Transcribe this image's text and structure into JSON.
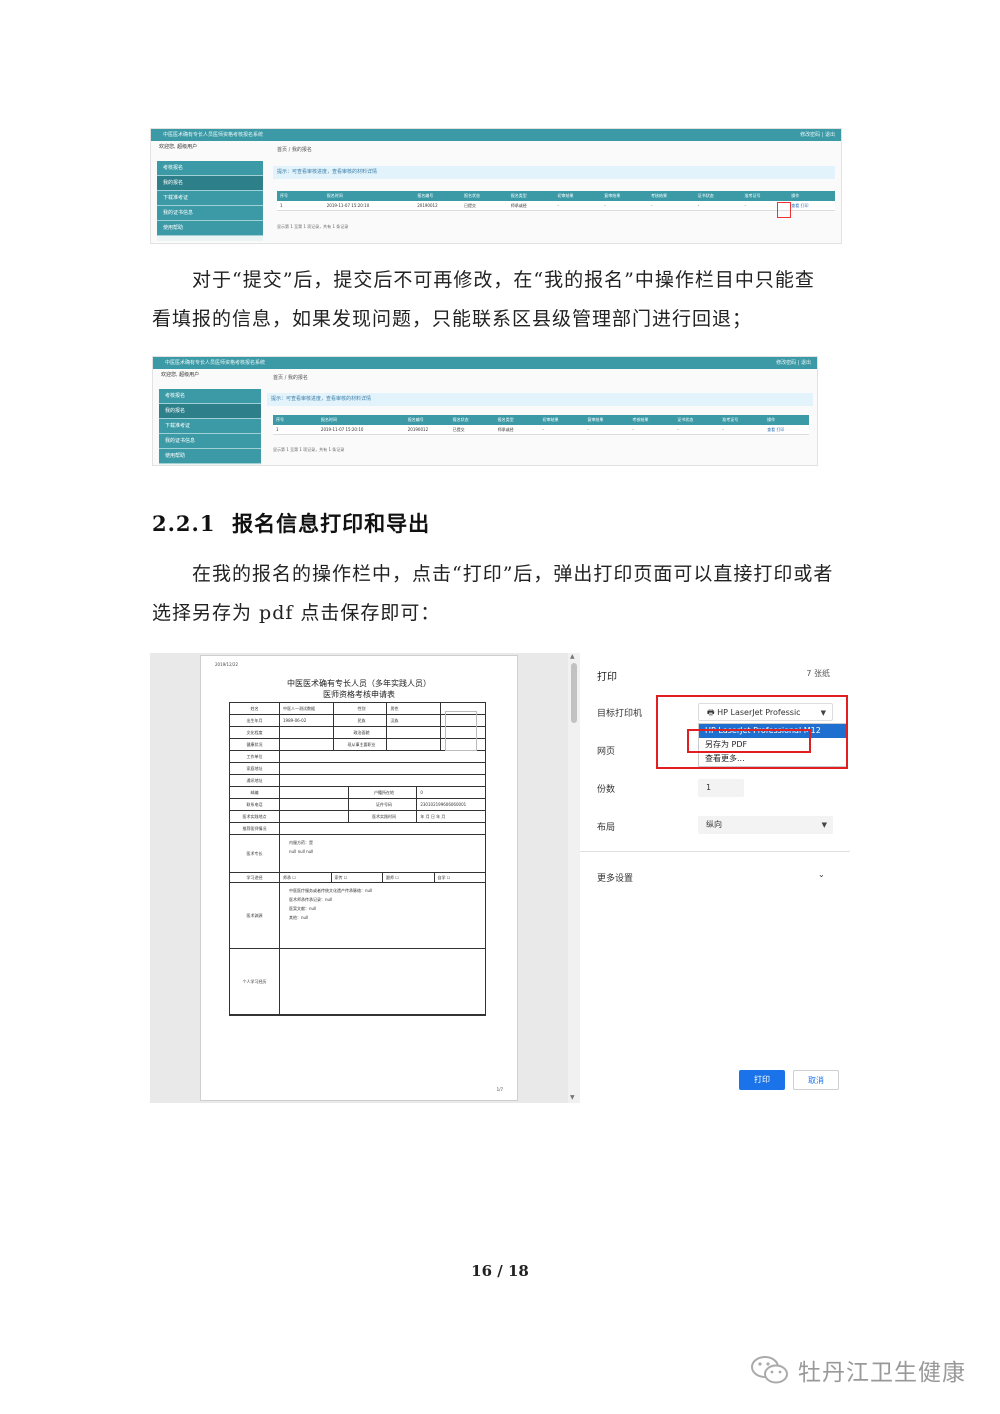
{
  "screenshot1": {
    "title": "中医医术确有专长人员医师资格考核报名系统",
    "top_right": "修改密码 | 退出",
    "user": "欢迎您, 超级用户",
    "breadcrumb": "首页 / 我的报名",
    "menu": [
      "考核报名",
      "我的报名",
      "下载准考证",
      "我的证书信息",
      "使用帮助"
    ],
    "tip": "提示：可查看审核进度，查看审核的材料详情",
    "headers": [
      "序号",
      "报名时间",
      "报名编号",
      "报名状态",
      "报名类型",
      "初审结果",
      "复审结果",
      "考核结果",
      "证书状态",
      "准考证号",
      "操作"
    ],
    "row": [
      "1",
      "2019-11-07 15:20:10",
      "20190012",
      "已提交",
      "师承或经",
      "-",
      "-",
      "-",
      "-",
      "-",
      "查看 打印"
    ],
    "pager": "显示第 1 至第 1 项记录，共有 1 条记录"
  },
  "paragraph1": {
    "line1": "对于“提交”后，提交后不可再修改，在“我的报名”中操作栏目中只能查",
    "line2": "看填报的信息，如果发现问题，只能联系区县级管理部门进行回退；"
  },
  "screenshot2": {
    "title": "中医医术确有专长人员医师资格考核报名系统",
    "top_right": "修改密码 | 退出",
    "user": "欢迎您, 超级用户",
    "breadcrumb": "首页 / 我的报名",
    "menu": [
      "考核报名",
      "我的报名",
      "下载准考证",
      "我的证书信息",
      "使用帮助"
    ],
    "tip": "提示：可查看审核进度，查看审核的材料详情",
    "headers": [
      "序号",
      "报名时间",
      "报名编号",
      "报名状态",
      "报名类型",
      "初审结果",
      "复审结果",
      "考核结果",
      "证书状态",
      "准考证号",
      "操作"
    ],
    "row": [
      "1",
      "2019-11-07 15:20:10",
      "20190012",
      "已提交",
      "师承或经",
      "-",
      "-",
      "-",
      "-",
      "-",
      "查看 打印"
    ],
    "pager": "显示第 1 至第 1 项记录，共有 1 条记录"
  },
  "section": {
    "number": "2.2.1",
    "title": "报名信息打印和导出"
  },
  "paragraph2": {
    "line1": "在我的报名的操作栏中，点击“打印”后，弹出打印页面可以直接打印或者",
    "line2": "选择另存为 pdf 点击保存即可："
  },
  "print_preview": {
    "date": "2019/12/22",
    "title_line1": "中医医术确有专长人员（多年实践人员）",
    "title_line2": "医师资格考核申请表",
    "fields": {
      "name_label": "姓名",
      "name_value": "中医人一测试数据",
      "sex_label": "性别",
      "sex_value": "男性",
      "birth_label": "出生年月",
      "birth_value": "1989-06-02",
      "nation_label": "民族",
      "nation_value": "汉族",
      "edu_label": "文化程度",
      "politics_label": "政治面貌",
      "health_label": "健康状况",
      "job_label": "现从事主要职业",
      "unit_label": "工作单位",
      "home_label": "家庭地址",
      "comm_label": "通讯地址",
      "postcode_label": "邮编",
      "hukou_label": "户籍所在地",
      "hukou_value": "0",
      "phone_label": "联系电话",
      "id_label": "证件号码",
      "id_value": "230102199606060001",
      "practice_addr_label": "医术实践地点",
      "practice_time_label": "医术实践时间",
      "date_units": "年    月    日    年    月",
      "ref_label": "推荐医师情况",
      "spec_label": "医术专长",
      "spec_items": [
        "内服方药：是",
        "null null null"
      ],
      "study_label": "学习途径",
      "study_options": [
        "师承",
        "家传",
        "跟师",
        "自学"
      ],
      "source_label": "医术渊源",
      "source_items": [
        "中医医疗服务或者传统文化遗产传承脉络：null",
        "医术师承传承记录：null",
        "医案文献：null",
        "其他：null"
      ],
      "resume_label": "个人学习经历"
    },
    "page": "1/7"
  },
  "print_settings": {
    "title": "打印",
    "sheets": "7 张纸",
    "destination_label": "目标打印机",
    "destination_value": "HP LaserJet Professic",
    "dropdown_options": [
      "HP LaserJet Professional M12",
      "另存为 PDF",
      "查看更多..."
    ],
    "pages_label": "网页",
    "copies_label": "份数",
    "copies_value": "1",
    "layout_label": "布局",
    "layout_value": "纵向",
    "more_label": "更多设置",
    "print_button": "打印",
    "cancel_button": "取消"
  },
  "footer": {
    "page": "16 / 18",
    "watermark": "牡丹江卫生健康"
  }
}
